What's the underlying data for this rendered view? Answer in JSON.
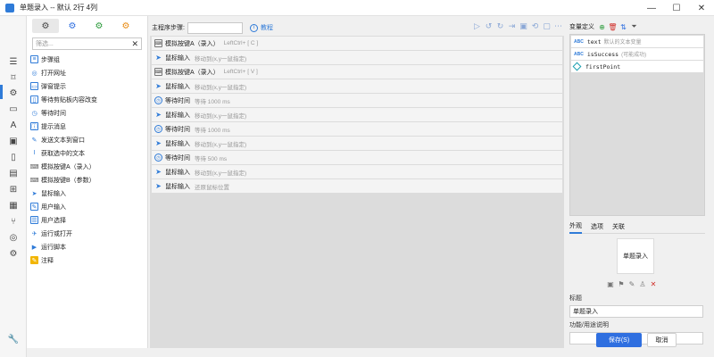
{
  "window": {
    "title": "单题录入 -- 默认 2行 4列",
    "controls": [
      "—",
      "☐",
      "✕"
    ]
  },
  "left_tabs": [
    "⚙",
    "⚙",
    "⚙",
    "⚙"
  ],
  "search": {
    "placeholder": "筛选...",
    "clear": "✕"
  },
  "commands": [
    {
      "label": "步骤组",
      "icon": "group-icon"
    },
    {
      "label": "打开网址",
      "icon": "globe-icon"
    },
    {
      "label": "弹窗提示",
      "icon": "popup-icon"
    },
    {
      "label": "等待剪贴板内容改变",
      "icon": "clipboard-icon"
    },
    {
      "label": "等待时间",
      "icon": "clock-icon"
    },
    {
      "label": "提示消息",
      "icon": "message-icon"
    },
    {
      "label": "发送文本到窗口",
      "icon": "send-text-icon"
    },
    {
      "label": "获取选中的文本",
      "icon": "text-cursor-icon"
    },
    {
      "label": "模拟按键A（录入）",
      "icon": "keyboard-icon"
    },
    {
      "label": "模拟按键B（参数）",
      "icon": "keyboard-icon"
    },
    {
      "label": "鼠标输入",
      "icon": "mouse-pointer-icon"
    },
    {
      "label": "用户输入",
      "icon": "user-input-icon"
    },
    {
      "label": "用户选择",
      "icon": "user-select-icon"
    },
    {
      "label": "运行或打开",
      "icon": "send-icon"
    },
    {
      "label": "运行脚本",
      "icon": "script-icon"
    },
    {
      "label": "注释",
      "icon": "note-icon"
    }
  ],
  "main": {
    "step_label": "主程序步骤:",
    "tutorial": "教程",
    "steps": [
      {
        "name": "模拟按键A（录入）",
        "detail": "LeftCtrl+ [ C ]",
        "type": "key"
      },
      {
        "name": "鼠标输入",
        "detail": "移动到(x,y一鼠指定)",
        "type": "mouse"
      },
      {
        "name": "模拟按键A（录入）",
        "detail": "LeftCtrl+ [ V ]",
        "type": "key"
      },
      {
        "name": "鼠标输入",
        "detail": "移动到(x,y一鼠指定)",
        "type": "mouse"
      },
      {
        "name": "等待时间",
        "detail": "等待 1000 ms",
        "type": "wait"
      },
      {
        "name": "鼠标输入",
        "detail": "移动到(x,y一鼠指定)",
        "type": "mouse"
      },
      {
        "name": "等待时间",
        "detail": "等待 1000 ms",
        "type": "wait"
      },
      {
        "name": "鼠标输入",
        "detail": "移动到(x,y一鼠指定)",
        "type": "mouse"
      },
      {
        "name": "等待时间",
        "detail": "等待 500 ms",
        "type": "wait"
      },
      {
        "name": "鼠标输入",
        "detail": "移动到(x,y一鼠指定)",
        "type": "mouse"
      },
      {
        "name": "鼠标输入",
        "detail": "还原鼠标位置",
        "type": "mouse"
      }
    ]
  },
  "variables": {
    "title": "变量定义",
    "items": [
      {
        "type": "ABC",
        "name": "text",
        "desc": "默认的文本变量"
      },
      {
        "type": "ABC",
        "name": "isSuccess",
        "desc": "(可能成功)"
      },
      {
        "type": "point",
        "name": "firstPoint",
        "desc": ""
      }
    ]
  },
  "props": {
    "tabs": [
      "外观",
      "选项",
      "关联"
    ],
    "preview_text": "单题录入",
    "title_label": "标题",
    "title_value": "单题录入",
    "desc_label": "功能/用途说明",
    "desc_value": ""
  },
  "buttons": {
    "save": "保存(S)",
    "cancel": "取消"
  },
  "colors": {
    "accent": "#2f6fe0",
    "delete": "#d0302a",
    "steps_bg": "#dcdcdc"
  }
}
